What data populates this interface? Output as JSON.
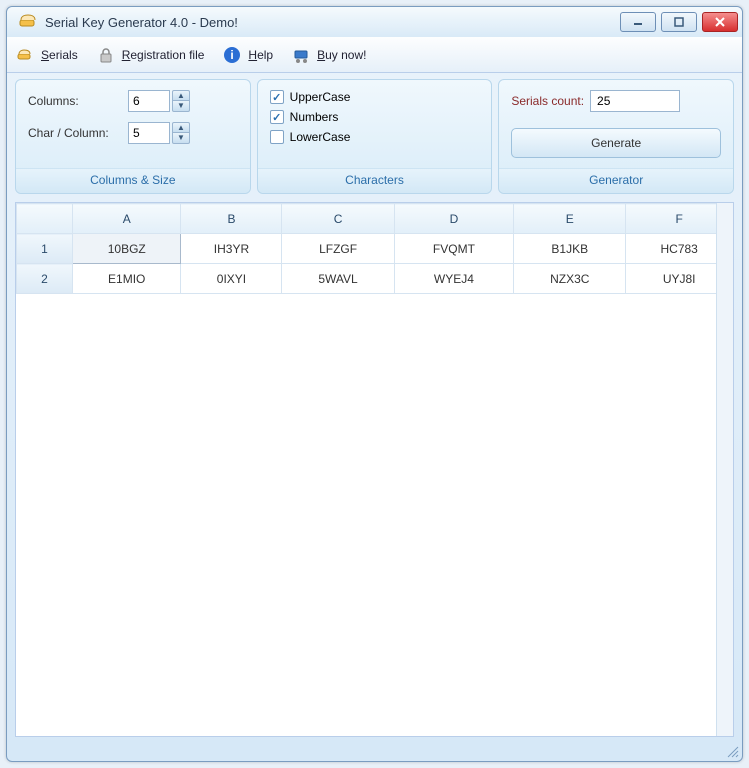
{
  "window": {
    "title": "Serial Key Generator 4.0 - Demo!"
  },
  "toolbar": {
    "serials": "Serials",
    "regfile": "Registration file",
    "help": "Help",
    "buynow": "Buy now!"
  },
  "panels": {
    "colsize": {
      "columns_label": "Columns:",
      "columns_value": "6",
      "charcol_label": "Char / Column:",
      "charcol_value": "5",
      "footer": "Columns & Size"
    },
    "chars": {
      "uppercase": "UpperCase",
      "numbers": "Numbers",
      "lowercase": "LowerCase",
      "footer": "Characters",
      "uppercase_checked": true,
      "numbers_checked": true,
      "lowercase_checked": false
    },
    "gen": {
      "count_label": "Serials count:",
      "count_value": "25",
      "button": "Generate",
      "footer": "Generator"
    }
  },
  "grid": {
    "headers": [
      "A",
      "B",
      "C",
      "D",
      "E",
      "F"
    ],
    "rows": [
      {
        "num": "1",
        "cells": [
          "10BGZ",
          "IH3YR",
          "LFZGF",
          "FVQMT",
          "B1JKB",
          "HC783"
        ]
      },
      {
        "num": "2",
        "cells": [
          "E1MIO",
          "0IXYI",
          "5WAVL",
          "WYEJ4",
          "NZX3C",
          "UYJ8I"
        ]
      }
    ]
  }
}
